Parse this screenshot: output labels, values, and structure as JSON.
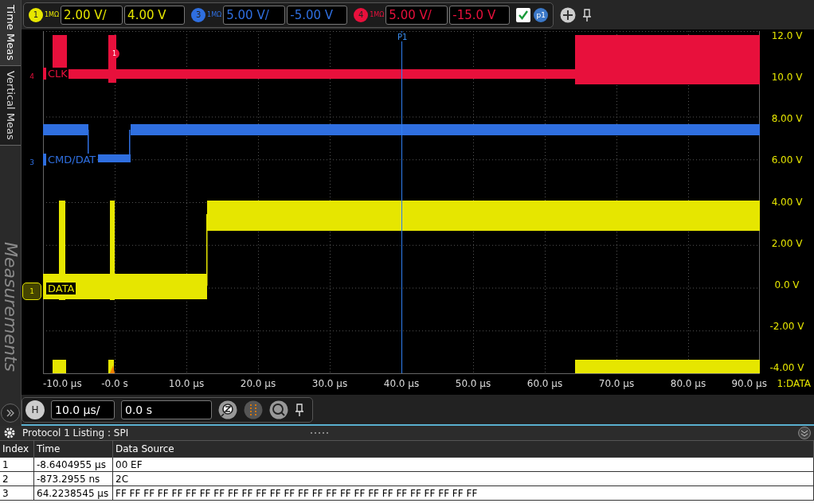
{
  "side_tabs": [
    {
      "label": "Time Meas",
      "selected": true
    },
    {
      "label": "Vertical Meas",
      "selected": false
    }
  ],
  "side_panel_title": "Measurements",
  "channels": [
    {
      "number": "1",
      "coupling": "1MΩ",
      "scale": "2.00 V/",
      "offset": "4.00 V",
      "color": "#e6e600"
    },
    {
      "number": "3",
      "coupling": "1MΩ",
      "scale": "5.00 V/",
      "offset": "-5.00 V",
      "color": "#2f6fe0"
    },
    {
      "number": "4",
      "coupling": "1MΩ",
      "scale": "5.00 V/",
      "offset": "-15.0 V",
      "color": "#e8103c"
    }
  ],
  "traces": [
    {
      "label": "CLK",
      "ground_number": "4",
      "color": "#e8103c",
      "selected": false
    },
    {
      "label": "CMD/DAT",
      "ground_number": "3",
      "color": "#2f6fe0",
      "selected": false
    },
    {
      "label": "DATA",
      "ground_number": "1",
      "color": "#e6e600",
      "selected": true
    }
  ],
  "toolbar_extras": {
    "checked": true,
    "cursor_button": "p1"
  },
  "cursor_label": "P1",
  "trigger_marker": "1",
  "y_axis_labels": [
    "12.0 V",
    "10.0 V",
    "8.00 V",
    "6.00 V",
    "4.00 V",
    "2.00 V",
    "0.0 V",
    "-2.00 V",
    "-4.00 V"
  ],
  "x_axis_labels": [
    "-10.0 µs",
    "-0.0 s",
    "10.0 µs",
    "20.0 µs",
    "30.0 µs",
    "40.0 µs",
    "50.0 µs",
    "60.0 µs",
    "70.0 µs",
    "80.0 µs",
    "90.0 µs"
  ],
  "trace_source_label": "1:DATA",
  "horizontal": {
    "button": "H",
    "scale": "10.0 µs/",
    "position": "0.0 s"
  },
  "listing": {
    "title": "Protocol 1 Listing : SPI",
    "columns": [
      "Index",
      "Time",
      "Data Source"
    ],
    "rows": [
      [
        "1",
        "-8.6404955 µs",
        "00 EF"
      ],
      [
        "2",
        "-873.2955 ns",
        "2C"
      ],
      [
        "3",
        "64.2238545 µs",
        "FF FF FF FF FF FF FF FF FF FF FF FF FF FF FF FF FF FF FF FF FF FF FF FF FF FF"
      ]
    ]
  }
}
